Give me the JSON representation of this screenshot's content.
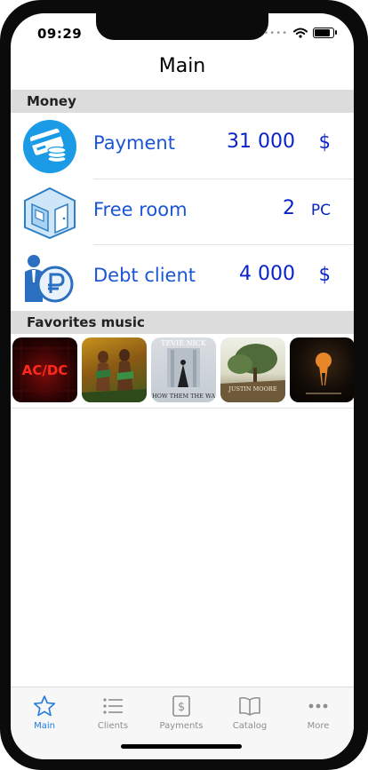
{
  "status": {
    "time": "09:29"
  },
  "nav": {
    "title": "Main"
  },
  "money": {
    "header": "Money",
    "rows": [
      {
        "label": "Payment",
        "value": "31 000",
        "unit": "$",
        "icon": "credit-card-icon"
      },
      {
        "label": "Free room",
        "value": "2",
        "unit": "PC",
        "icon": "room-icon"
      },
      {
        "label": "Debt client",
        "value": "4 000",
        "unit": "$",
        "icon": "debt-client-icon"
      }
    ]
  },
  "music": {
    "header": "Favorites music",
    "covers": [
      {
        "name": "album-cover-1",
        "logo_text": "AC/DC"
      },
      {
        "name": "album-cover-2"
      },
      {
        "name": "album-cover-3",
        "top_text": "TEVIE NICK",
        "bottom_text": "HOW THEM THE WA"
      },
      {
        "name": "album-cover-4",
        "text": "JUSTIN MOORE"
      },
      {
        "name": "album-cover-5"
      }
    ]
  },
  "tabbar": {
    "tabs": [
      {
        "label": "Main",
        "icon": "star-icon",
        "active": true
      },
      {
        "label": "Clients",
        "icon": "list-icon",
        "active": false
      },
      {
        "label": "Payments",
        "icon": "dollar-doc-icon",
        "active": false
      },
      {
        "label": "Catalog",
        "icon": "book-icon",
        "active": false
      },
      {
        "label": "More",
        "icon": "more-dots-icon",
        "active": false
      }
    ]
  },
  "colors": {
    "accent": "#1f7ae0",
    "label_blue": "#1a56d6",
    "value_blue": "#0a23c9",
    "section_bg": "#dcdcdc"
  }
}
